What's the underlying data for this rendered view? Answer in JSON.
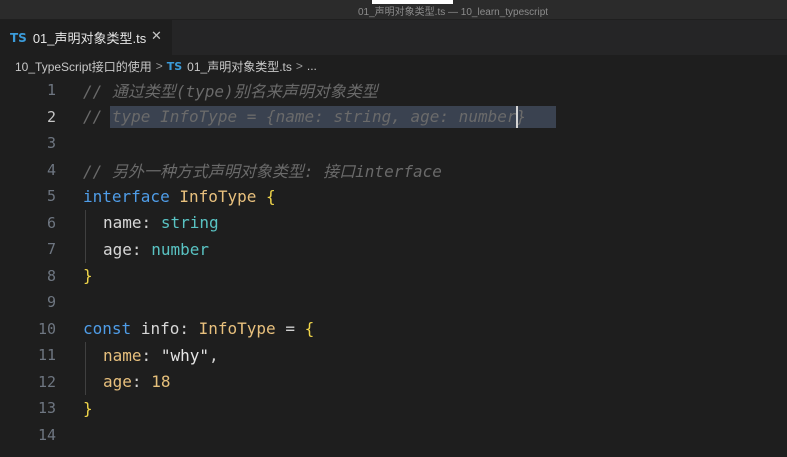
{
  "window": {
    "title": "01_声明对象类型.ts — 10_learn_typescript"
  },
  "tab": {
    "icon": "TS",
    "label": "01_声明对象类型.ts",
    "close": "✕"
  },
  "breadcrumb": {
    "folder": "10_TypeScript接口的使用",
    "sep1": ">",
    "icon": "TS",
    "file": "01_声明对象类型.ts",
    "sep2": ">",
    "more": "..."
  },
  "editor": {
    "line_numbers": [
      "1",
      "2",
      "3",
      "4",
      "5",
      "6",
      "7",
      "8",
      "9",
      "10",
      "11",
      "12",
      "13",
      "14"
    ],
    "active_line": "2",
    "lines": {
      "l1": {
        "comment": "// 通过类型(type)别名来声明对象类型"
      },
      "l2": {
        "comment": "// type InfoType = {name: string, age: number}"
      },
      "l4": {
        "comment": "// 另外一种方式声明对象类型: 接口interface"
      },
      "l5": {
        "kw": "interface",
        "name": "InfoType",
        "brace": "{"
      },
      "l6": {
        "prop": "name",
        "colon": ":",
        "type": "string"
      },
      "l7": {
        "prop": "age",
        "colon": ":",
        "type": "number"
      },
      "l8": {
        "brace": "}"
      },
      "l10": {
        "kw": "const",
        "var": "info",
        "colon": ":",
        "type": "InfoType",
        "eq": "=",
        "brace": "{"
      },
      "l11": {
        "prop": "name",
        "colon": ":",
        "value": "\"why\"",
        "comma": ","
      },
      "l12": {
        "prop": "age",
        "colon": ":",
        "value": "18"
      },
      "l13": {
        "brace": "}"
      }
    }
  },
  "colors": {
    "background": "#1e1e1e",
    "comment": "#6a6a6a",
    "keyword": "#4f9de8",
    "type": "#e8c07d",
    "brace": "#f0d54a",
    "builtin_type": "#59c3c3",
    "ts_icon": "#3b9bd9"
  }
}
